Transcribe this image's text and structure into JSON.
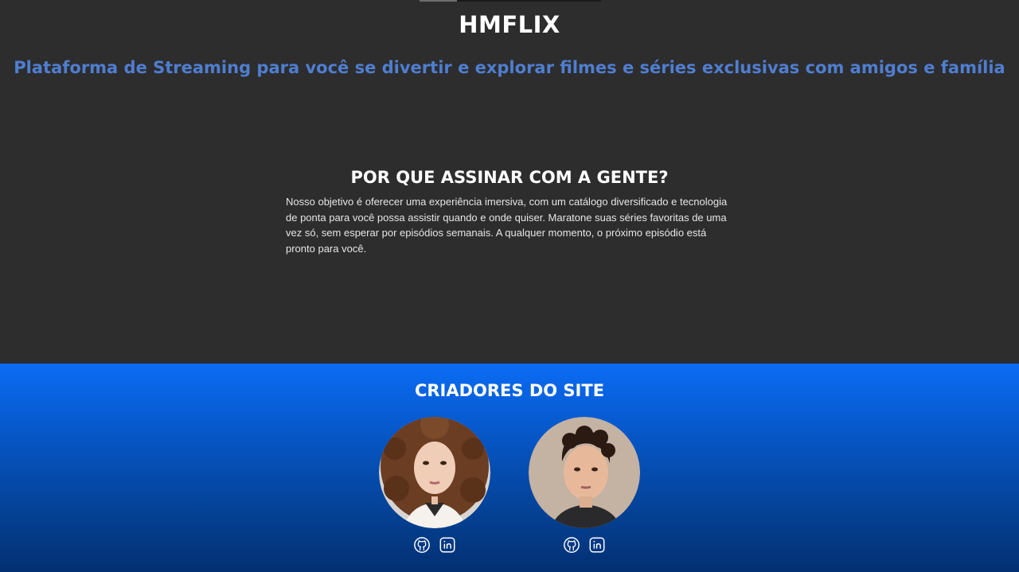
{
  "header": {
    "brand": "HMFLIX",
    "tagline": "Plataforma de Streaming para você se divertir e explorar filmes e séries exclusivas com amigos e família"
  },
  "why": {
    "title": "POR QUE ASSINAR COM A GENTE?",
    "text": "Nosso objetivo é oferecer uma experiência imersiva, com um catálogo diversificado e tecnologia de ponta para você possa assistir quando e onde quiser. Maratone suas séries favoritas de uma vez só, sem esperar por episódios semanais. A qualquer momento, o próximo episódio está pronto para você."
  },
  "creators": {
    "title": "CRIADORES DO SITE",
    "people": [
      {
        "icons": [
          "github-icon",
          "linkedin-icon"
        ]
      },
      {
        "icons": [
          "github-icon",
          "linkedin-icon"
        ]
      }
    ]
  },
  "colors": {
    "page_bg": "#2d2d2e",
    "tagline": "#4f7ed0",
    "creators_bg_top": "#0b6cf4",
    "creators_bg_bottom": "#033072"
  }
}
